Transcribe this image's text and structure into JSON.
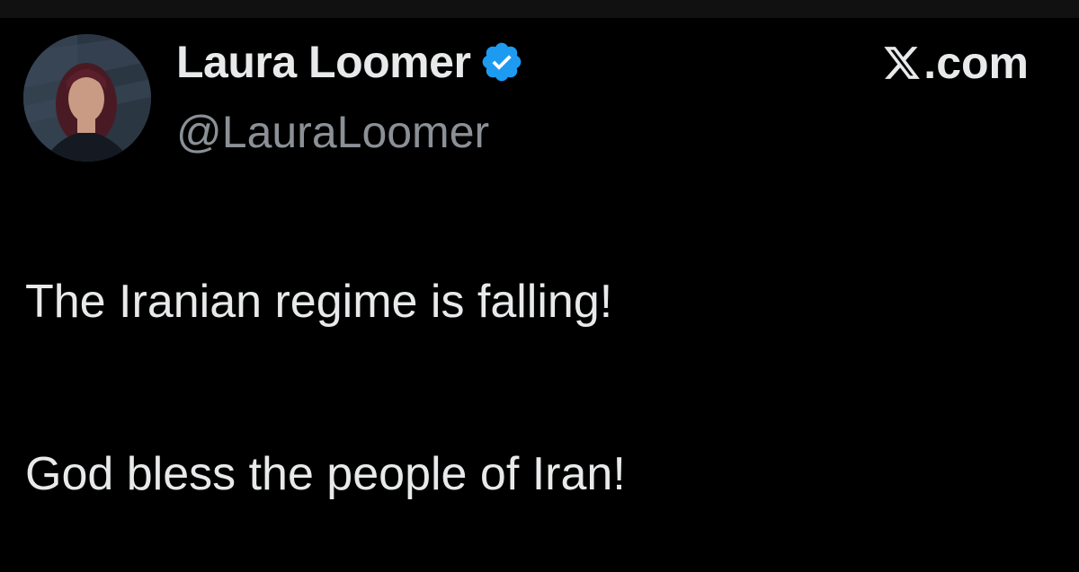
{
  "author": {
    "display_name": "Laura Loomer",
    "handle": "@LauraLoomer",
    "verified": true,
    "verified_icon": "verified-badge-icon",
    "avatar_icon": "profile-photo"
  },
  "brand": {
    "logo_icon": "x-logo-icon",
    "suffix": ".com"
  },
  "tweet": {
    "lines": [
      "The Iranian regime is falling!",
      "God bless the people of Iran!"
    ]
  },
  "colors": {
    "background": "#000000",
    "text_primary": "#e7e9ea",
    "text_secondary": "#8b9096",
    "verified_blue": "#1d9bf0"
  }
}
